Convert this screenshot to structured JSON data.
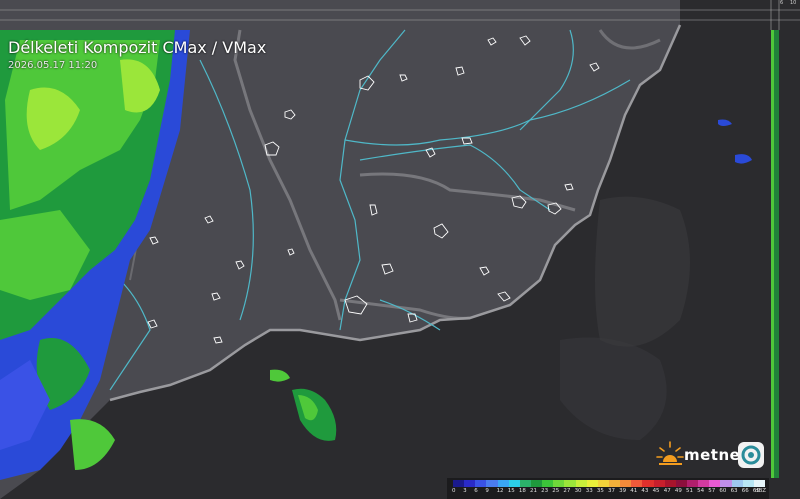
{
  "title": "Délkeleti Kompozit CMax / VMax",
  "timestamp": "2026.05.17 11:20",
  "logo": {
    "text": "metnet",
    "icon": "sun-icon"
  },
  "top_axis": {
    "ticks": [
      "6",
      "10"
    ]
  },
  "legend": {
    "unit_values": [
      "0",
      "3",
      "6",
      "9",
      "12",
      "15",
      "18",
      "21",
      "23",
      "25",
      "27",
      "30",
      "33",
      "35",
      "37",
      "39",
      "41",
      "43",
      "45",
      "47",
      "49",
      "51",
      "54",
      "57",
      "60",
      "63",
      "66",
      "69",
      "dBZ"
    ],
    "colors": [
      "#1a1a8c",
      "#2a2ac8",
      "#3a52e6",
      "#4a7cf0",
      "#3aa6f5",
      "#2ccfe8",
      "#2bb26a",
      "#1f9a3d",
      "#3cc43a",
      "#6fd83a",
      "#9be63a",
      "#c8ef3a",
      "#e9ef3a",
      "#f2d23a",
      "#f2b03a",
      "#f28a3a",
      "#ef5a3a",
      "#e0302c",
      "#c81f2c",
      "#a8142c",
      "#8c0f3c",
      "#b01f6c",
      "#d23aa0",
      "#e85ad2",
      "#c08ee8",
      "#9ec8f0",
      "#b8e6f5",
      "#e6f5fa"
    ]
  },
  "colors": {
    "land": "#4a4a50",
    "sea": "#2b2b2e",
    "river": "#4fb8c8",
    "border": "#8a8a8e"
  }
}
